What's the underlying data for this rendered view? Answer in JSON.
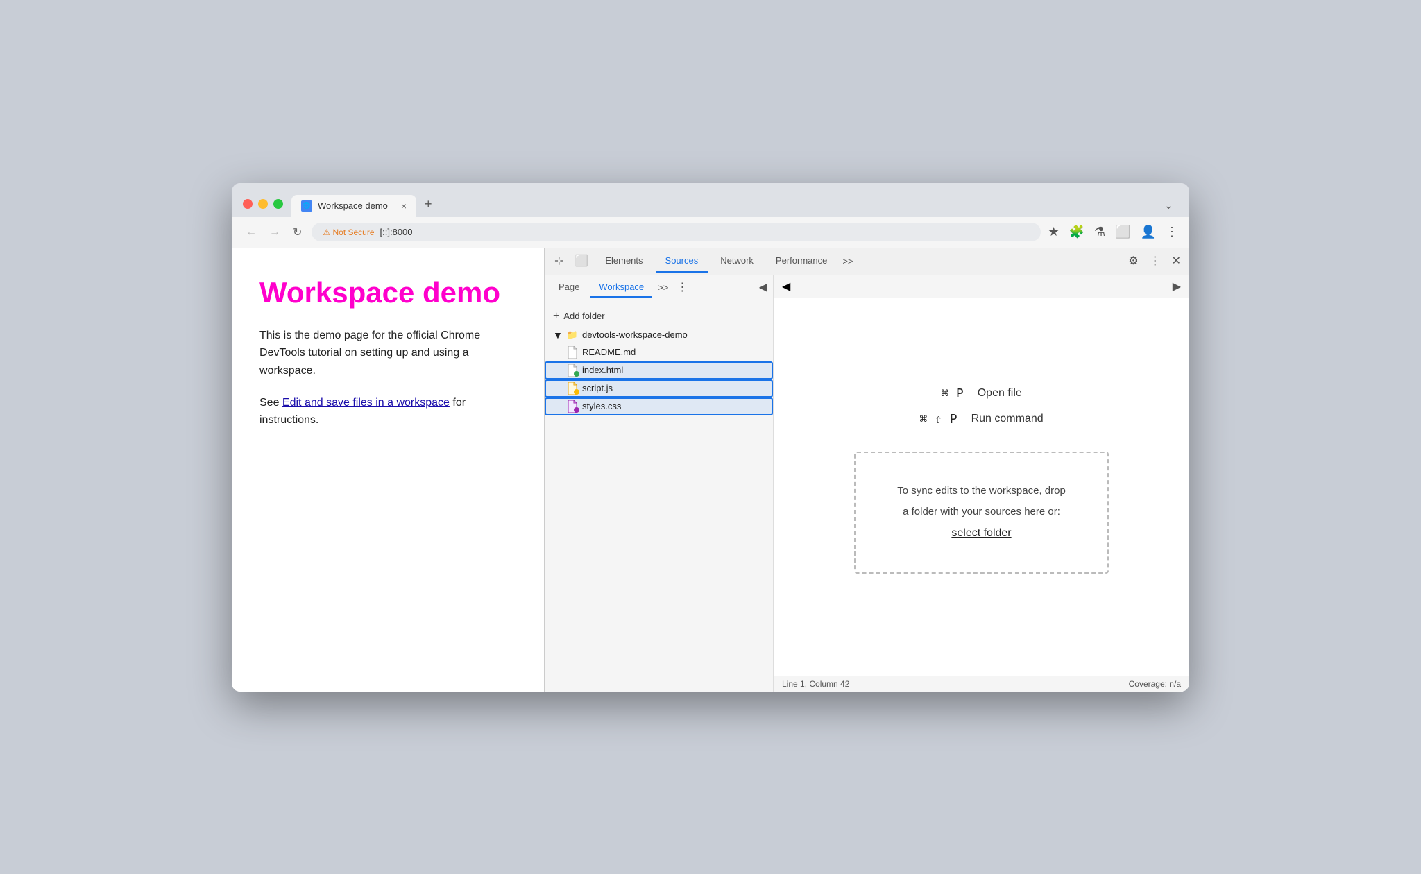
{
  "browser": {
    "tab": {
      "title": "Workspace demo",
      "favicon": "🌐",
      "close": "×"
    },
    "tab_new": "+",
    "tab_more": "⌄",
    "nav": {
      "back": "←",
      "forward": "→",
      "refresh": "↻"
    },
    "address": {
      "security_label": "⚠ Not Secure",
      "url": "[::]:8000"
    },
    "toolbar_icons": [
      "★",
      "🧩",
      "⚗",
      "⬜",
      "👤",
      "⋮"
    ]
  },
  "page": {
    "title": "Workspace demo",
    "description1": "This is the demo page for the official Chrome DevTools tutorial on setting up and using a workspace.",
    "description2_prefix": "See ",
    "description2_link": "Edit and save files in a workspace",
    "description2_suffix": " for instructions."
  },
  "devtools": {
    "tabs": [
      {
        "id": "elements",
        "label": "Elements",
        "active": false
      },
      {
        "id": "sources",
        "label": "Sources",
        "active": true
      },
      {
        "id": "network",
        "label": "Network",
        "active": false
      },
      {
        "id": "performance",
        "label": "Performance",
        "active": false
      }
    ],
    "more_tabs": ">>",
    "settings_icon": "⚙",
    "kebab_icon": "⋮",
    "close_icon": "✕",
    "cursor_icon": "⊹",
    "device_icon": "⬜"
  },
  "sources": {
    "tabs": [
      {
        "id": "page",
        "label": "Page",
        "active": false
      },
      {
        "id": "workspace",
        "label": "Workspace",
        "active": true
      }
    ],
    "more": ">>",
    "options": "⋮",
    "collapse_left": "◀",
    "collapse_right": "▶",
    "add_folder": "+ Add folder",
    "folder": {
      "name": "devtools-workspace-demo",
      "files": [
        {
          "name": "README.md",
          "dot": null
        },
        {
          "name": "index.html",
          "dot": "green"
        },
        {
          "name": "script.js",
          "dot": "orange"
        },
        {
          "name": "styles.css",
          "dot": "purple"
        }
      ]
    },
    "shortcuts": [
      {
        "keys": "⌘ P",
        "label": "Open file"
      },
      {
        "keys": "⌘ ⇧ P",
        "label": "Run command"
      }
    ],
    "drop_zone": {
      "line1": "To sync edits to the workspace, drop",
      "line2": "a folder with your sources here or:",
      "link": "select folder"
    },
    "status": {
      "left": "Line 1, Column 42",
      "right": "Coverage: n/a"
    }
  }
}
